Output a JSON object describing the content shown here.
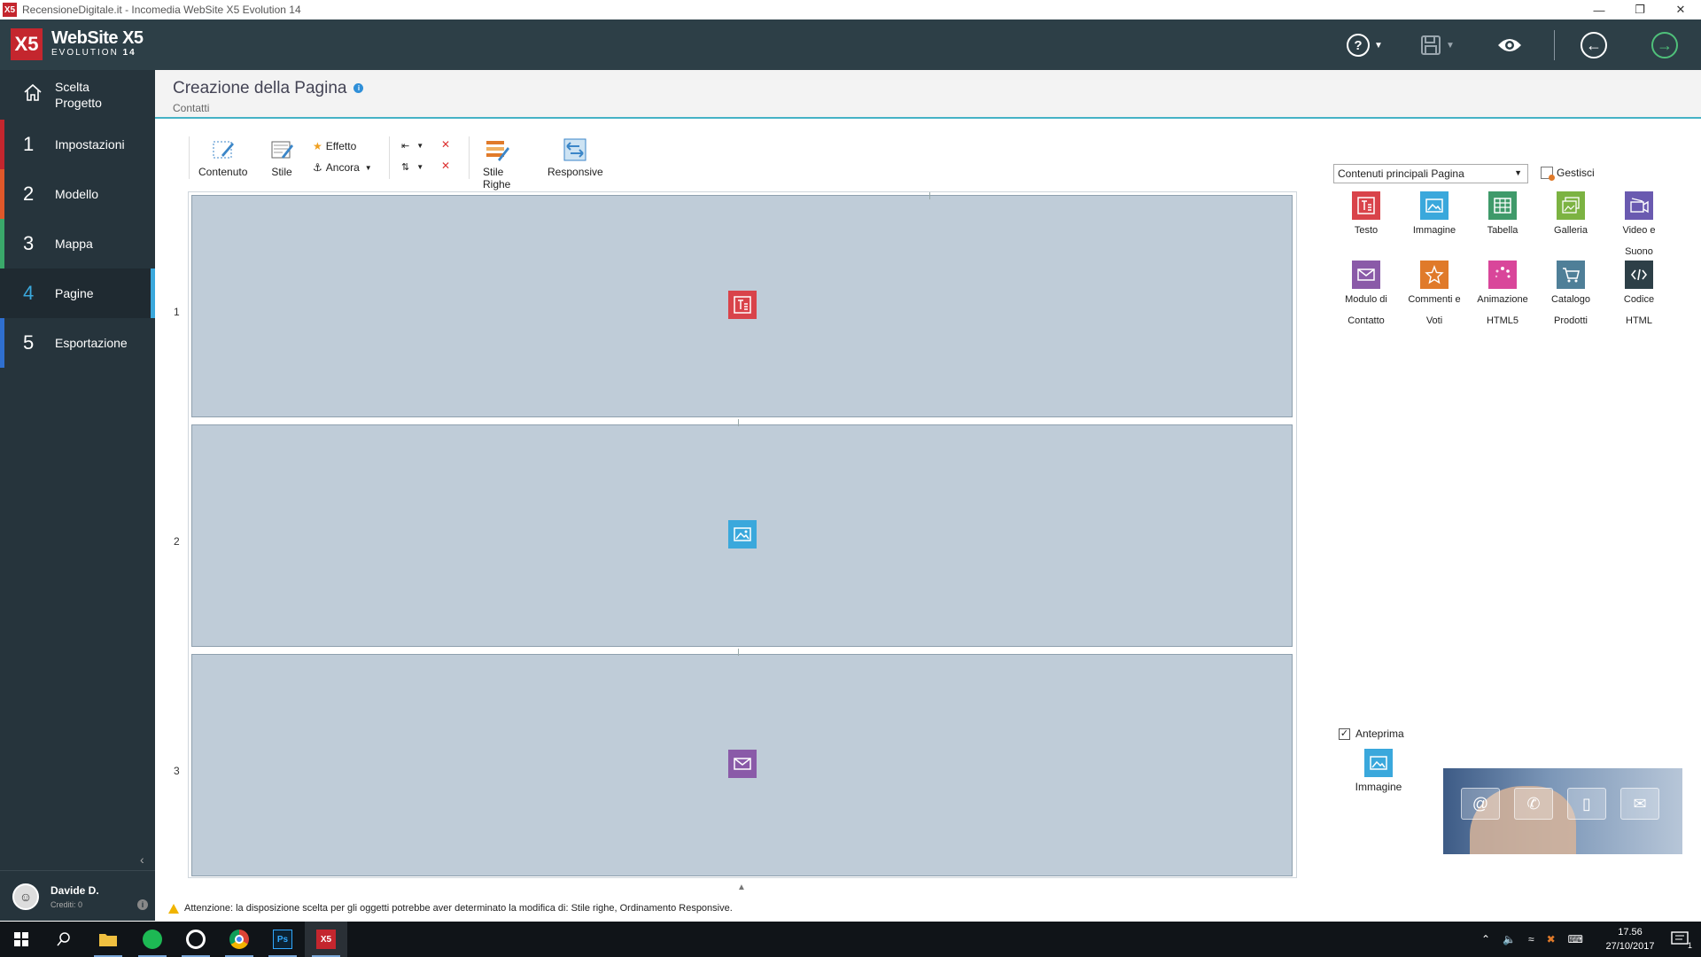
{
  "window": {
    "title": "RecensioneDigitale.it - Incomedia WebSite X5 Evolution 14"
  },
  "brand": {
    "name": "WebSite X5",
    "edition": "EVOLUTION",
    "version": "14"
  },
  "sidebar": {
    "home": {
      "label_line1": "Scelta",
      "label_line2": "Progetto"
    },
    "items": [
      {
        "num": "1",
        "label": "Impostazioni",
        "color": "#c4262e"
      },
      {
        "num": "2",
        "label": "Modello",
        "color": "#e0582a"
      },
      {
        "num": "3",
        "label": "Mappa",
        "color": "#3aa86a"
      },
      {
        "num": "4",
        "label": "Pagine",
        "color": "#3aa8dc"
      },
      {
        "num": "5",
        "label": "Esportazione",
        "color": "#2f6fcf"
      }
    ],
    "user": {
      "name": "Davide D.",
      "credits": "Crediti: 0"
    }
  },
  "page": {
    "title": "Creazione della Pagina",
    "subtitle": "Contatti"
  },
  "toolbar": {
    "contenuto": "Contenuto",
    "stile": "Stile",
    "effetto": "Effetto",
    "ancora": "Ancora",
    "stile_righe": "Stile Righe",
    "responsive": "Responsive"
  },
  "grid": {
    "rows": [
      {
        "num": "1",
        "object": "testo-icon",
        "color": "#d9434a"
      },
      {
        "num": "2",
        "object": "immagine-icon",
        "color": "#3aa8dc"
      },
      {
        "num": "3",
        "object": "modulo-icon",
        "color": "#8a5aa8"
      }
    ]
  },
  "objects_panel": {
    "dropdown": "Contenuti principali Pagina",
    "gestisci": "Gestisci",
    "items": [
      {
        "label1": "Testo",
        "label2": "",
        "color": "#d9434a",
        "icon": "text-icon"
      },
      {
        "label1": "Immagine",
        "label2": "",
        "color": "#3aa8dc",
        "icon": "image-icon"
      },
      {
        "label1": "Tabella",
        "label2": "",
        "color": "#3f9a6a",
        "icon": "table-icon"
      },
      {
        "label1": "Galleria",
        "label2": "",
        "color": "#7cb342",
        "icon": "gallery-icon"
      },
      {
        "label1": "Video e",
        "label2": "Suono",
        "color": "#6a5ab0",
        "icon": "video-icon"
      },
      {
        "label1": "Modulo di",
        "label2": "Contatto",
        "color": "#8a5aa8",
        "icon": "mail-icon"
      },
      {
        "label1": "Commenti e",
        "label2": "Voti",
        "color": "#e07a2a",
        "icon": "star-icon"
      },
      {
        "label1": "Animazione",
        "label2": "HTML5",
        "color": "#d9469a",
        "icon": "animation-icon"
      },
      {
        "label1": "Catalogo",
        "label2": "Prodotti",
        "color": "#4f7f98",
        "icon": "cart-icon"
      },
      {
        "label1": "Codice",
        "label2": "HTML",
        "color": "#2d3f47",
        "icon": "code-icon"
      }
    ]
  },
  "preview": {
    "checkbox_label": "Anteprima",
    "object_label": "Immagine"
  },
  "warning": "Attenzione: la disposizione scelta per gli oggetti potrebbe aver determinato la modifica di: Stile righe, Ordinamento Responsive.",
  "taskbar": {
    "time": "17.56",
    "date": "27/10/2017",
    "notifications": "1"
  }
}
